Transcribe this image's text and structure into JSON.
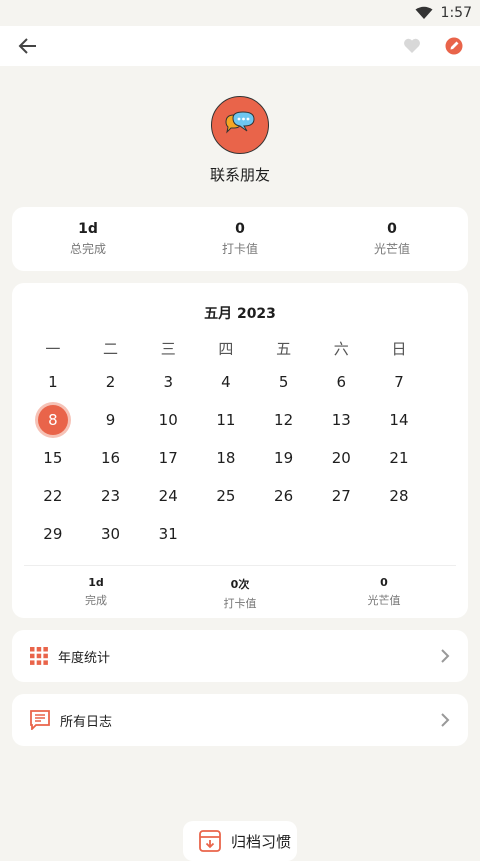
{
  "status": {
    "time": "1:57"
  },
  "habit": {
    "name": "联系朋友"
  },
  "summary": [
    {
      "value": "1d",
      "label": "总完成"
    },
    {
      "value": "0",
      "label": "打卡值"
    },
    {
      "value": "0",
      "label": "光芒值"
    }
  ],
  "calendar": {
    "title": "五月 2023",
    "weekdays": [
      "一",
      "二",
      "三",
      "四",
      "五",
      "六",
      "日"
    ],
    "selected_day": "8",
    "rows": [
      [
        "1",
        "2",
        "3",
        "4",
        "5",
        "6",
        "7"
      ],
      [
        "8",
        "9",
        "10",
        "11",
        "12",
        "13",
        "14"
      ],
      [
        "15",
        "16",
        "17",
        "18",
        "19",
        "20",
        "21"
      ],
      [
        "22",
        "23",
        "24",
        "25",
        "26",
        "27",
        "28"
      ],
      [
        "29",
        "30",
        "31",
        "",
        "",
        "",
        ""
      ]
    ],
    "footer": [
      {
        "value": "1d",
        "label": "完成"
      },
      {
        "value": "0次",
        "label": "打卡值"
      },
      {
        "value": "0",
        "label": "光芒值"
      }
    ]
  },
  "rows": {
    "annual": "年度统计",
    "logs": "所有日志"
  },
  "archive_button": "归档习惯",
  "colors": {
    "accent": "#e9644a",
    "background": "#f5f4f0"
  }
}
